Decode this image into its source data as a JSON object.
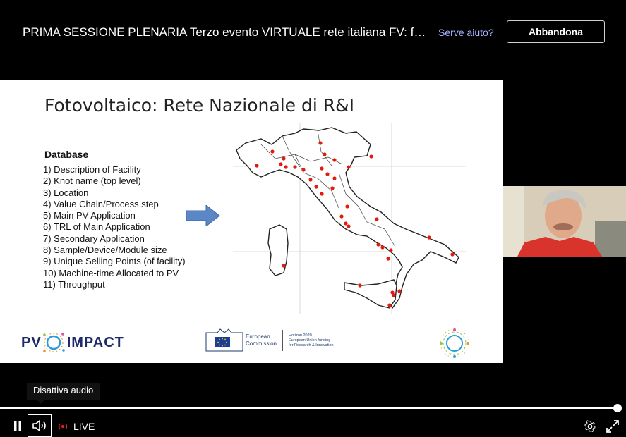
{
  "header": {
    "title": "PRIMA SESSIONE PLENARIA Terzo evento VIRTUALE rete italiana FV: fl...",
    "help_link": "Serve aiuto?",
    "leave_button": "Abbandona"
  },
  "slide": {
    "title": "Fotovoltaico: Rete Nazionale di R&I",
    "database_heading": "Database",
    "database_items": [
      "1) Description of Facility",
      "2) Knot name (top level)",
      "3) Location",
      "4) Value Chain/Process step",
      "5) Main PV Application",
      "6) TRL of Main Application",
      "7) Secondary Application",
      "8) Sample/Device/Module size",
      "9) Unique Selling Points (of facility)",
      "10) Machine-time Allocated to PV",
      "11) Throughput"
    ],
    "logos": {
      "pv_impact_left": "PV",
      "pv_impact_right": "IMPACT",
      "ec_line1": "European",
      "ec_line2": "Commission",
      "h2020_line1": "Horizon 2020",
      "h2020_line2": "European Union funding",
      "h2020_line3": "for Research & Innovation"
    },
    "map_icon": "italy-map",
    "arrow_icon": "right-arrow-icon",
    "dot_color": "#e31b0f"
  },
  "player": {
    "tooltip": "Disattiva audio",
    "live_label": "LIVE",
    "progress": 1.0,
    "accent_live": "#e0202a"
  }
}
